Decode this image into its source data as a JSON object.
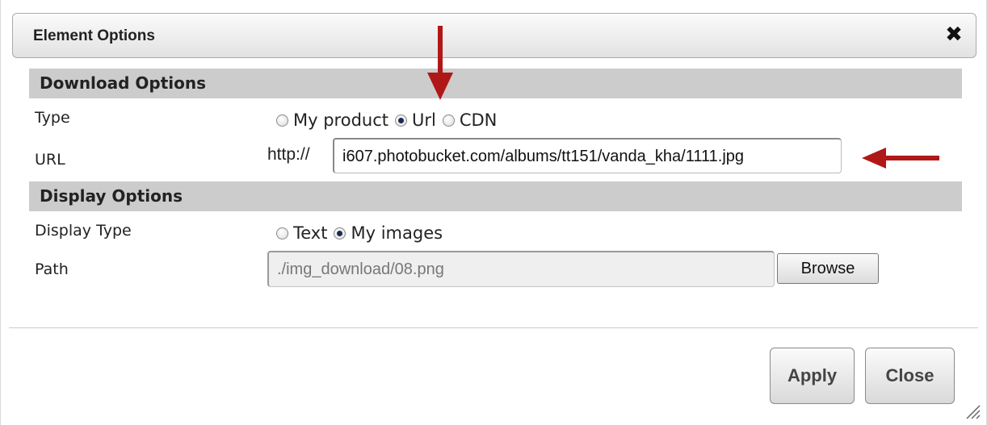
{
  "dialog": {
    "title": "Element Options",
    "close_icon": "close-x-icon"
  },
  "download_options": {
    "header": "Download Options",
    "type_label": "Type",
    "type_options": [
      {
        "label": "My product",
        "checked": false
      },
      {
        "label": "Url",
        "checked": true
      },
      {
        "label": "CDN",
        "checked": false
      }
    ],
    "url_label": "URL",
    "url_prefix": "http://",
    "url_value": "i607.photobucket.com/albums/tt151/vanda_kha/1111.jpg"
  },
  "display_options": {
    "header": "Display Options",
    "display_type_label": "Display Type",
    "display_type_options": [
      {
        "label": "Text",
        "checked": false
      },
      {
        "label": "My images",
        "checked": true
      }
    ],
    "path_label": "Path",
    "path_value": "./img_download/08.png",
    "browse_label": "Browse"
  },
  "footer": {
    "apply_label": "Apply",
    "close_label": "Close"
  },
  "annotations": {
    "arrow_color": "#b01818",
    "arrow_icon": "red-arrow-icon"
  }
}
